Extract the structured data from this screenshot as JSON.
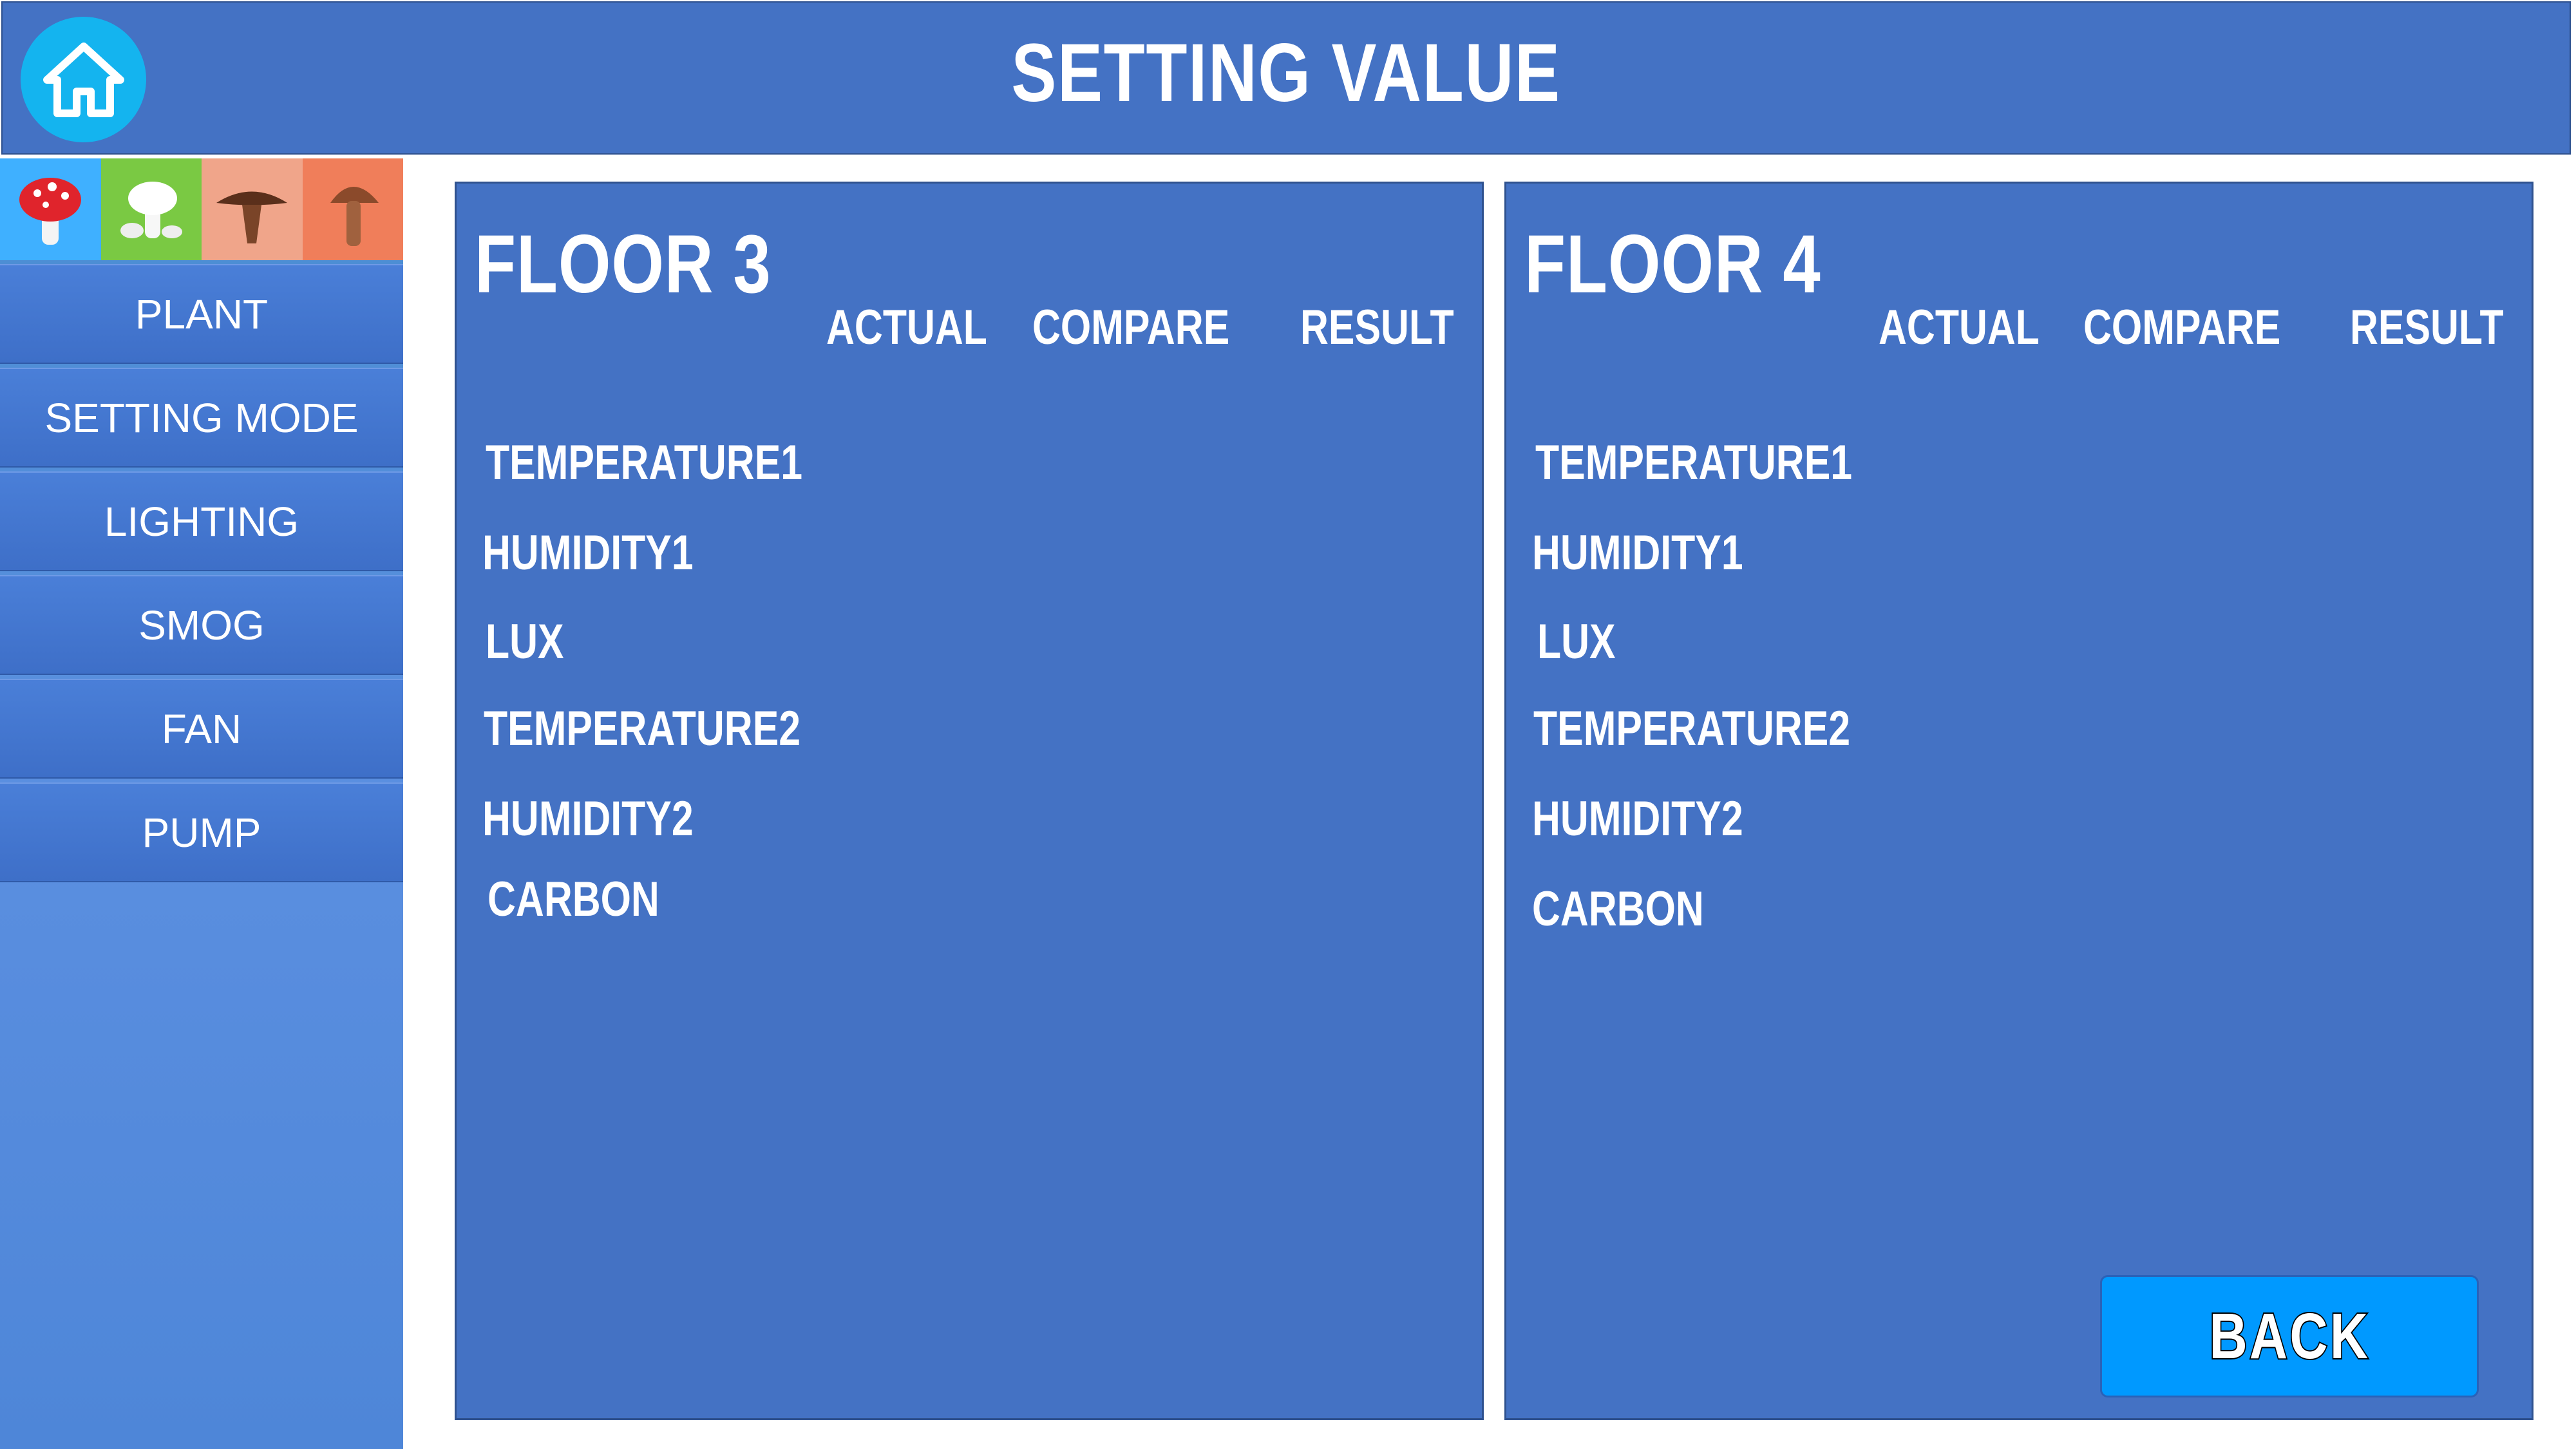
{
  "header": {
    "title": "SETTING VALUE",
    "home_icon": "home-icon"
  },
  "sidebar": {
    "icons": [
      {
        "name": "red-mushroom-icon",
        "bg": "#3fb0ff"
      },
      {
        "name": "white-mushroom-icon",
        "bg": "#7ac943"
      },
      {
        "name": "brown-flat-mushroom-icon",
        "bg": "#f0a58a"
      },
      {
        "name": "brown-tall-mushroom-icon",
        "bg": "#f07e5a"
      }
    ],
    "items": [
      {
        "label": "PLANT"
      },
      {
        "label": "SETTING MODE"
      },
      {
        "label": "LIGHTING"
      },
      {
        "label": "SMOG"
      },
      {
        "label": "FAN"
      },
      {
        "label": "PUMP"
      }
    ]
  },
  "panels": [
    {
      "title": "FLOOR 3",
      "columns": [
        "ACTUAL",
        "COMPARE",
        "RESULT"
      ],
      "rows": [
        "TEMPERATURE1",
        "HUMIDITY1",
        "LUX",
        "TEMPERATURE2",
        "HUMIDITY2",
        "CARBON"
      ]
    },
    {
      "title": "FLOOR 4",
      "columns": [
        "ACTUAL",
        "COMPARE",
        "RESULT"
      ],
      "rows": [
        "TEMPERATURE1",
        "HUMIDITY1",
        "LUX",
        "TEMPERATURE2",
        "HUMIDITY2",
        "CARBON"
      ]
    }
  ],
  "back_button": {
    "label": "BACK"
  },
  "colors": {
    "header_bg": "#4472c4",
    "panel_bg": "#4472c4",
    "home_button": "#14b4ef",
    "back_button": "#0099ff"
  }
}
